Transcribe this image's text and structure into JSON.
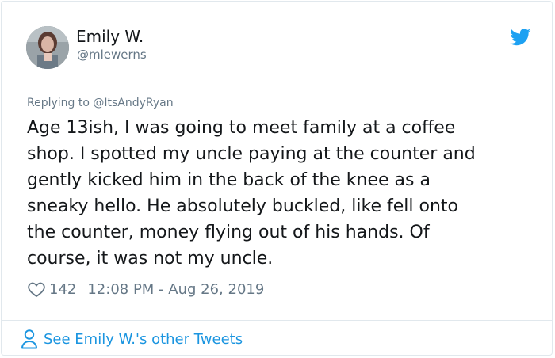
{
  "author": {
    "display_name": "Emily W.",
    "handle": "@mlewerns",
    "avatar_icon": "user-avatar-photo"
  },
  "brand": {
    "icon": "twitter-bird-icon",
    "color": "#1da1f2"
  },
  "reply": {
    "text": "Replying to @ItsAndyRyan"
  },
  "tweet": {
    "lines": [
      "Age 13ish, I was going to meet family at a coffee",
      "shop. I spotted my uncle paying at the counter and",
      "gently kicked him in the back of the knee as a",
      "sneaky hello. He absolutely buckled, like fell onto",
      "the counter, money flying out of his hands. Of",
      "course, it was not my uncle."
    ]
  },
  "meta": {
    "likes": "142",
    "timestamp": "12:08 PM - Aug 26, 2019",
    "heart_icon": "heart-outline-icon"
  },
  "footer": {
    "link_text": "See Emily W.'s other Tweets",
    "icon": "person-outline-icon",
    "link_color": "#1b95e0"
  }
}
